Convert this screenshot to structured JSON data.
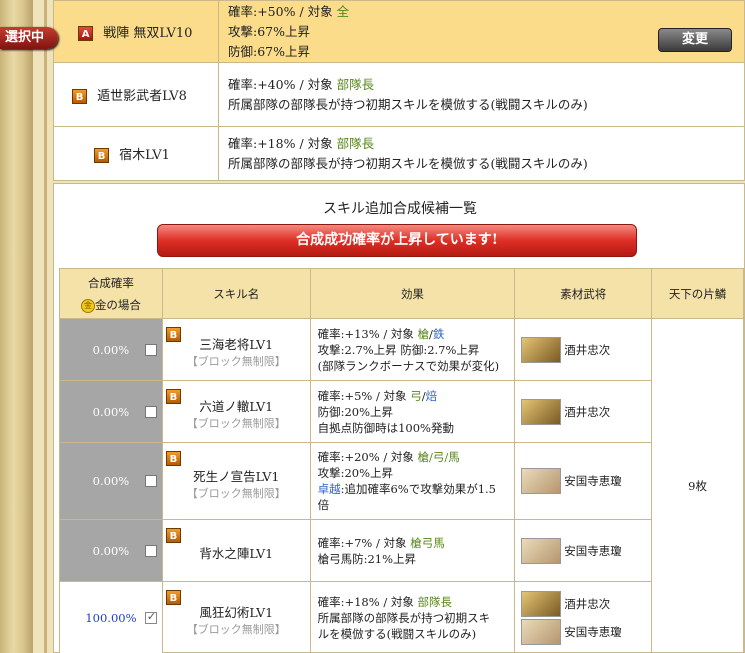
{
  "selected_badge": "選択中",
  "change_button": "変更",
  "current": [
    {
      "rank": "A",
      "name": "戦陣 無双LV10",
      "lines": [
        {
          "pre": "確率:+50%  /  対象  ",
          "tgt": "全"
        },
        {
          "pre": "攻撃:67%上昇",
          "tgt": ""
        },
        {
          "pre": "防御:67%上昇",
          "tgt": ""
        }
      ]
    },
    {
      "rank": "B",
      "name": "遁世影武者LV8",
      "lines": [
        {
          "pre": "確率:+40%  /  対象  ",
          "tgt": "部隊長"
        },
        {
          "pre": "所属部隊の部隊長が持つ初期スキルを模倣する(戦闘スキルのみ)",
          "tgt": ""
        }
      ]
    },
    {
      "rank": "B",
      "name": "宿木LV1",
      "lines": [
        {
          "pre": "確率:+18%  /  対象  ",
          "tgt": "部隊長"
        },
        {
          "pre": "所属部隊の部隊長が持つ初期スキルを模倣する(戦闘スキルのみ)",
          "tgt": ""
        }
      ]
    }
  ],
  "panel": {
    "title": "スキル追加合成候補一覧",
    "banner": "合成成功確率が上昇しています!",
    "headers": {
      "prob": "合成確率",
      "gold_label": "金の場合",
      "gold_icon": "金",
      "skill": "スキル名",
      "effect": "効果",
      "material": "素材武将",
      "pieces": "天下の片鱗"
    },
    "pieces_value": "9枚",
    "rows": [
      {
        "prob": "0.00%",
        "checked": false,
        "rank": "B",
        "name": "三海老将LV1",
        "sub": "【ブロック無制限】",
        "effect": [
          [
            {
              "t": "確率:+13%  /  対象  "
            },
            {
              "t": "槍",
              "c": "green"
            },
            {
              "t": "/"
            },
            {
              "t": "鉄",
              "c": "blue"
            }
          ],
          [
            {
              "t": "攻撃:2.7%上昇  防御:2.7%上昇"
            }
          ],
          [
            {
              "t": "(部隊ランクボーナスで効果が変化)"
            }
          ]
        ],
        "mats": [
          {
            "name": "酒井忠次",
            "por": "sakai"
          }
        ]
      },
      {
        "prob": "0.00%",
        "checked": false,
        "rank": "B",
        "name": "六道ノ轍LV1",
        "sub": "【ブロック無制限】",
        "effect": [
          [
            {
              "t": "確率:+5%  /  対象  "
            },
            {
              "t": "弓",
              "c": "green"
            },
            {
              "t": "/"
            },
            {
              "t": "焙",
              "c": "blue"
            }
          ],
          [
            {
              "t": "防御:20%上昇"
            }
          ],
          [
            {
              "t": "自拠点防御時は100%発動"
            }
          ]
        ],
        "mats": [
          {
            "name": "酒井忠次",
            "por": "sakai"
          }
        ]
      },
      {
        "prob": "0.00%",
        "checked": false,
        "rank": "B",
        "name": "死生ノ宣告LV1",
        "sub": "【ブロック無制限】",
        "effect": [
          [
            {
              "t": "確率:+20%  /  対象  "
            },
            {
              "t": "槍/弓/馬",
              "c": "green"
            }
          ],
          [
            {
              "t": "攻撃:20%上昇"
            }
          ],
          [
            {
              "t": "卓越",
              "c": "blue"
            },
            {
              "t": ":追加確率6%で攻撃効果が1.5"
            }
          ],
          [
            {
              "t": "倍"
            }
          ]
        ],
        "mats": [
          {
            "name": "安国寺恵瓊",
            "por": "ankoku"
          }
        ]
      },
      {
        "prob": "0.00%",
        "checked": false,
        "rank": "B",
        "name": "背水之陣LV1",
        "sub": "",
        "effect": [
          [
            {
              "t": "確率:+7%  /  対象  "
            },
            {
              "t": "槍弓馬",
              "c": "green"
            }
          ],
          [
            {
              "t": "槍弓馬防:21%上昇"
            }
          ]
        ],
        "mats": [
          {
            "name": "安国寺恵瓊",
            "por": "ankoku"
          }
        ]
      },
      {
        "prob": "100.00%",
        "checked": true,
        "rank": "B",
        "name": "風狂幻術LV1",
        "sub": "【ブロック無制限】",
        "effect": [
          [
            {
              "t": "確率:+18%  /  対象  "
            },
            {
              "t": "部隊長",
              "c": "green"
            }
          ],
          [
            {
              "t": "所属部隊の部隊長が持つ初期スキ"
            }
          ],
          [
            {
              "t": "ルを模倣する(戦闘スキルのみ)"
            }
          ]
        ],
        "mats": [
          {
            "name": "酒井忠次",
            "por": "sakai"
          },
          {
            "name": "安国寺恵瓊",
            "por": "ankoku"
          }
        ]
      }
    ]
  }
}
